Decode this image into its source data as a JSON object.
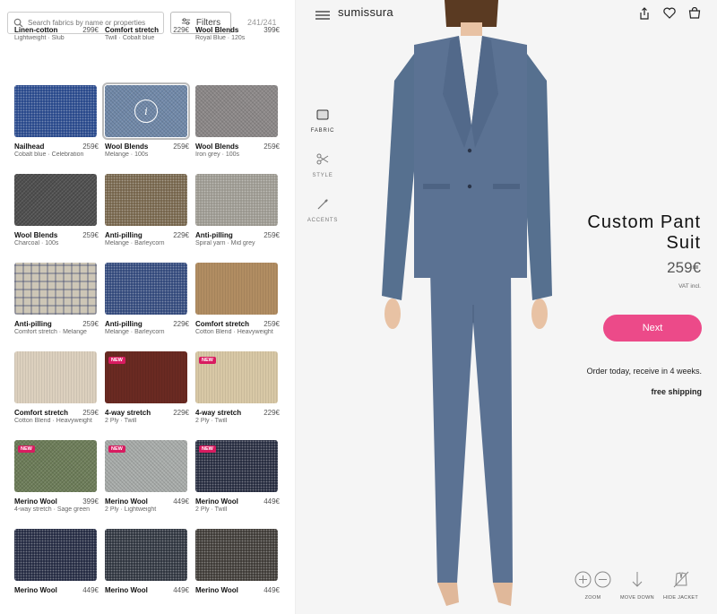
{
  "search": {
    "placeholder": "Search fabrics by name or properties"
  },
  "filters_label": "Filters",
  "count": "241/241",
  "fabrics": [
    {
      "name": "Linen-cotton",
      "price": "299€",
      "sub": "Lightweight · Slub",
      "color": null
    },
    {
      "name": "Comfort stretch",
      "price": "229€",
      "sub": "Twill · Cobalt blue",
      "color": null
    },
    {
      "name": "Wool Blends",
      "price": "399€",
      "sub": "Royal Blue · 120s",
      "color": null
    },
    {
      "name": "Nailhead",
      "price": "259€",
      "sub": "Cobalt blue · Celebration",
      "color": "#2a4a8c",
      "texture": "t-texture"
    },
    {
      "name": "Wool Blends",
      "price": "259€",
      "sub": "Melange · 100s",
      "color": "#7088a8",
      "texture": "t-noise",
      "selected": true
    },
    {
      "name": "Wool Blends",
      "price": "259€",
      "sub": "Iron grey · 100s",
      "color": "#8c8888",
      "texture": "t-noise"
    },
    {
      "name": "Wool Blends",
      "price": "259€",
      "sub": "Charcoal · 100s",
      "color": "#4e4e4e",
      "texture": "t-noise"
    },
    {
      "name": "Anti-pilling",
      "price": "229€",
      "sub": "Melange · Barleycorn",
      "color": "#76654c",
      "texture": "t-texture"
    },
    {
      "name": "Anti-pilling",
      "price": "259€",
      "sub": "Spiral yarn · Mid grey",
      "color": "#9a978f",
      "texture": "t-texture"
    },
    {
      "name": "Anti-pilling",
      "price": "259€",
      "sub": "Comfort stretch · Melange",
      "color": "#cdc6b6",
      "texture": "t-check"
    },
    {
      "name": "Anti-pilling",
      "price": "229€",
      "sub": "Melange · Barleycorn",
      "color": "#344a7c",
      "texture": "t-texture"
    },
    {
      "name": "Comfort stretch",
      "price": "259€",
      "sub": "Cotton Blend · Heavyweight",
      "color": "#b18d62",
      "texture": "t-stripe"
    },
    {
      "name": "Comfort stretch",
      "price": "259€",
      "sub": "Cotton Blend · Heavyweight",
      "color": "#dcd0be",
      "texture": "t-stripe"
    },
    {
      "name": "4-way stretch",
      "price": "229€",
      "sub": "2 Ply · Twill",
      "color": "#6a2a22",
      "texture": "t-stripe",
      "new": true
    },
    {
      "name": "4-way stretch",
      "price": "229€",
      "sub": "2 Ply · Twill",
      "color": "#d8c8a6",
      "texture": "t-stripe",
      "new": true
    },
    {
      "name": "Merino Wool",
      "price": "399€",
      "sub": "4-way stretch · Sage green",
      "color": "#6c7c58",
      "texture": "t-noise",
      "new": true
    },
    {
      "name": "Merino Wool",
      "price": "449€",
      "sub": "2 Ply · Lightweight",
      "color": "#a8acaa",
      "texture": "t-noise",
      "new": true
    },
    {
      "name": "Merino Wool",
      "price": "449€",
      "sub": "2 Ply · Twill",
      "color": "#272d40",
      "texture": "t-texture",
      "new": true
    },
    {
      "name": "Merino Wool",
      "price": "449€",
      "sub": "",
      "color": "#262c44",
      "texture": "t-texture"
    },
    {
      "name": "Merino Wool",
      "price": "449€",
      "sub": "",
      "color": "#303640",
      "texture": "t-texture"
    },
    {
      "name": "Merino Wool",
      "price": "449€",
      "sub": "",
      "color": "#403c38",
      "texture": "t-texture"
    }
  ],
  "new_label": "NEW",
  "info_glyph": "i",
  "brand": "sumissura",
  "tabs": [
    {
      "label": "FABRIC",
      "icon": "fabric-icon"
    },
    {
      "label": "STYLE",
      "icon": "scissors-icon"
    },
    {
      "label": "ACCENTS",
      "icon": "needle-icon"
    }
  ],
  "product": {
    "title": "Custom Pant Suit",
    "price": "259€",
    "vat": "VAT incl."
  },
  "next_label": "Next",
  "order_text": "Order today, receive in 4 weeks.",
  "shipping_text": "free shipping",
  "bottom": {
    "zoom": "ZOOM",
    "move_down": "MOVE DOWN",
    "hide_jacket": "HIDE JACKET"
  },
  "colors": {
    "accent": "#ec4a89",
    "suit": "#5b7293",
    "new_badge": "#d81b60"
  }
}
